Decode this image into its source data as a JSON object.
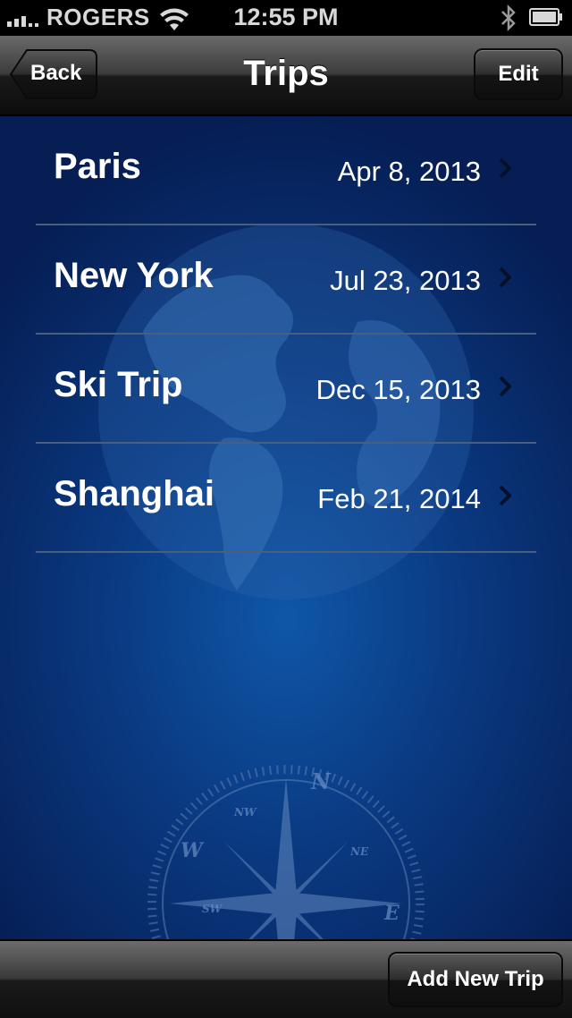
{
  "status_bar": {
    "carrier": "ROGERS",
    "time": "12:55 PM"
  },
  "navbar": {
    "back_label": "Back",
    "title": "Trips",
    "edit_label": "Edit"
  },
  "trips": [
    {
      "name": "Paris",
      "date": "Apr 8, 2013"
    },
    {
      "name": "New York",
      "date": "Jul 23, 2013"
    },
    {
      "name": "Ski Trip",
      "date": "Dec 15, 2013"
    },
    {
      "name": "Shanghai",
      "date": "Feb 21, 2014"
    }
  ],
  "compass": {
    "n": "N",
    "e": "E",
    "w": "W",
    "ne": "NE",
    "nw": "NW",
    "sw": "SW"
  },
  "toolbar": {
    "add_label": "Add New Trip"
  }
}
